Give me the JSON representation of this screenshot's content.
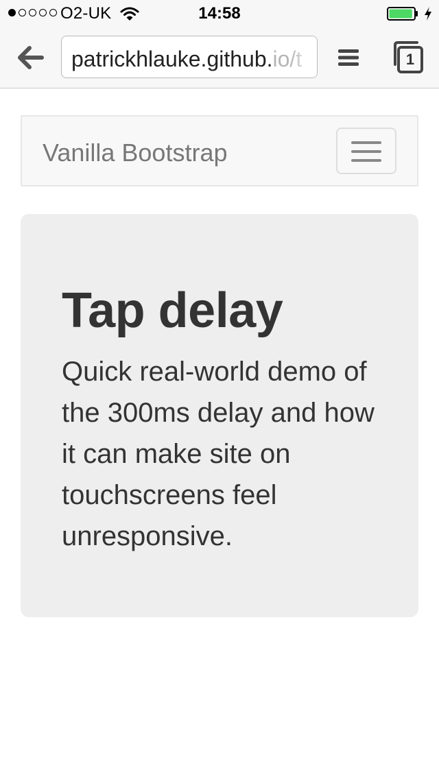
{
  "status_bar": {
    "carrier": "O2-UK",
    "time": "14:58",
    "signal_bars_filled": 1,
    "signal_bars_total": 5,
    "battery_level": 0.95
  },
  "browser": {
    "url_main": "patrickhlauke.github.",
    "url_dim": "io/t",
    "tab_count": "1",
    "icons": {
      "back": "back-arrow-icon",
      "menu": "hamburger-menu-icon",
      "tabs": "tabs-icon"
    }
  },
  "navbar": {
    "brand": "Vanilla Bootstrap",
    "toggle_icon": "hamburger-icon"
  },
  "jumbotron": {
    "title": "Tap delay",
    "lead": "Quick real-world demo of the 300ms delay and how it can make site on touchscreens feel unresponsive."
  },
  "colors": {
    "chrome_bg": "#f7f7f7",
    "battery_fill": "#4cd964",
    "navbar_bg": "#f8f8f8",
    "jumbotron_bg": "#eeeeee",
    "text_dark": "#333333",
    "brand_text": "#777777"
  }
}
